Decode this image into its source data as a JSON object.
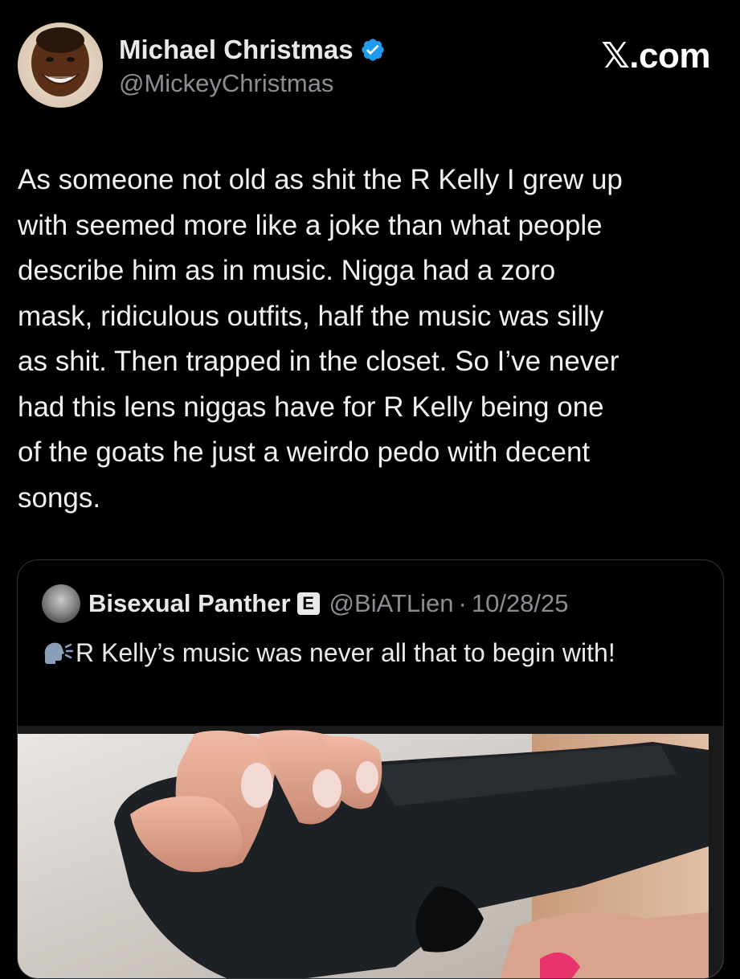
{
  "author": {
    "display_name": "Michael Christmas",
    "handle": "@MickeyChristmas",
    "verified": true
  },
  "brand": "𝕏.com",
  "post": {
    "text": "As someone not old as shit the R Kelly I grew up\nwith seemed more like a joke than what people\ndescribe him as in music. Nigga had a zoro\nmask, ridiculous outfits, half the music was silly\nas shit. Then trapped in the closet. So I’ve never\nhad this lens niggas have for R Kelly being one\nof the goats he just a weirdo pedo with decent\nsongs."
  },
  "quote": {
    "display_name": "Bisexual Panther",
    "badge": "E",
    "handle": "@BiATLien",
    "separator": "·",
    "date": "10/28/25",
    "text": "R Kelly’s music was never all that to begin with!",
    "leading_emoji": "speaking-head-icon",
    "media": "photo-icon"
  },
  "colors": {
    "background": "#000000",
    "text": "#e7e9ea",
    "secondary_text": "#8b8f94",
    "verified": "#1d9bf0",
    "border": "#2f3336"
  }
}
